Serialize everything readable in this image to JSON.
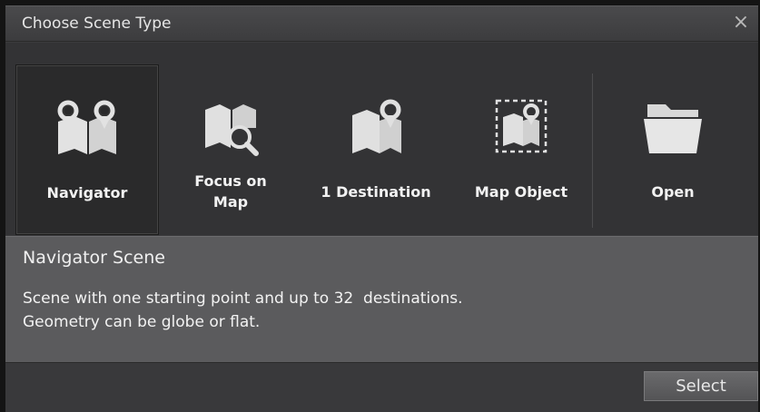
{
  "dialog": {
    "title": "Choose Scene Type",
    "close_glyph": "×"
  },
  "tiles": [
    {
      "label": "Navigator",
      "icon": "map-two-pins-icon",
      "selected": true
    },
    {
      "label": "Focus on Map",
      "label_line1": "Focus on",
      "label_line2": "Map",
      "icon": "map-magnifier-icon",
      "selected": false
    },
    {
      "label": "1 Destination",
      "icon": "map-one-pin-icon",
      "selected": false
    },
    {
      "label": "Map Object",
      "icon": "map-object-dashed-icon",
      "selected": false
    },
    {
      "label": "Open",
      "icon": "folder-icon",
      "selected": false
    }
  ],
  "description": {
    "title": "Navigator Scene",
    "line1": "Scene with one starting point and up to 32  destinations.",
    "line2": "Geometry can be globe or flat."
  },
  "footer": {
    "select_label": "Select"
  },
  "colors": {
    "background": "#3a3a3c",
    "description_panel": "#5b5b5d",
    "icon": "#e0e0e0"
  }
}
